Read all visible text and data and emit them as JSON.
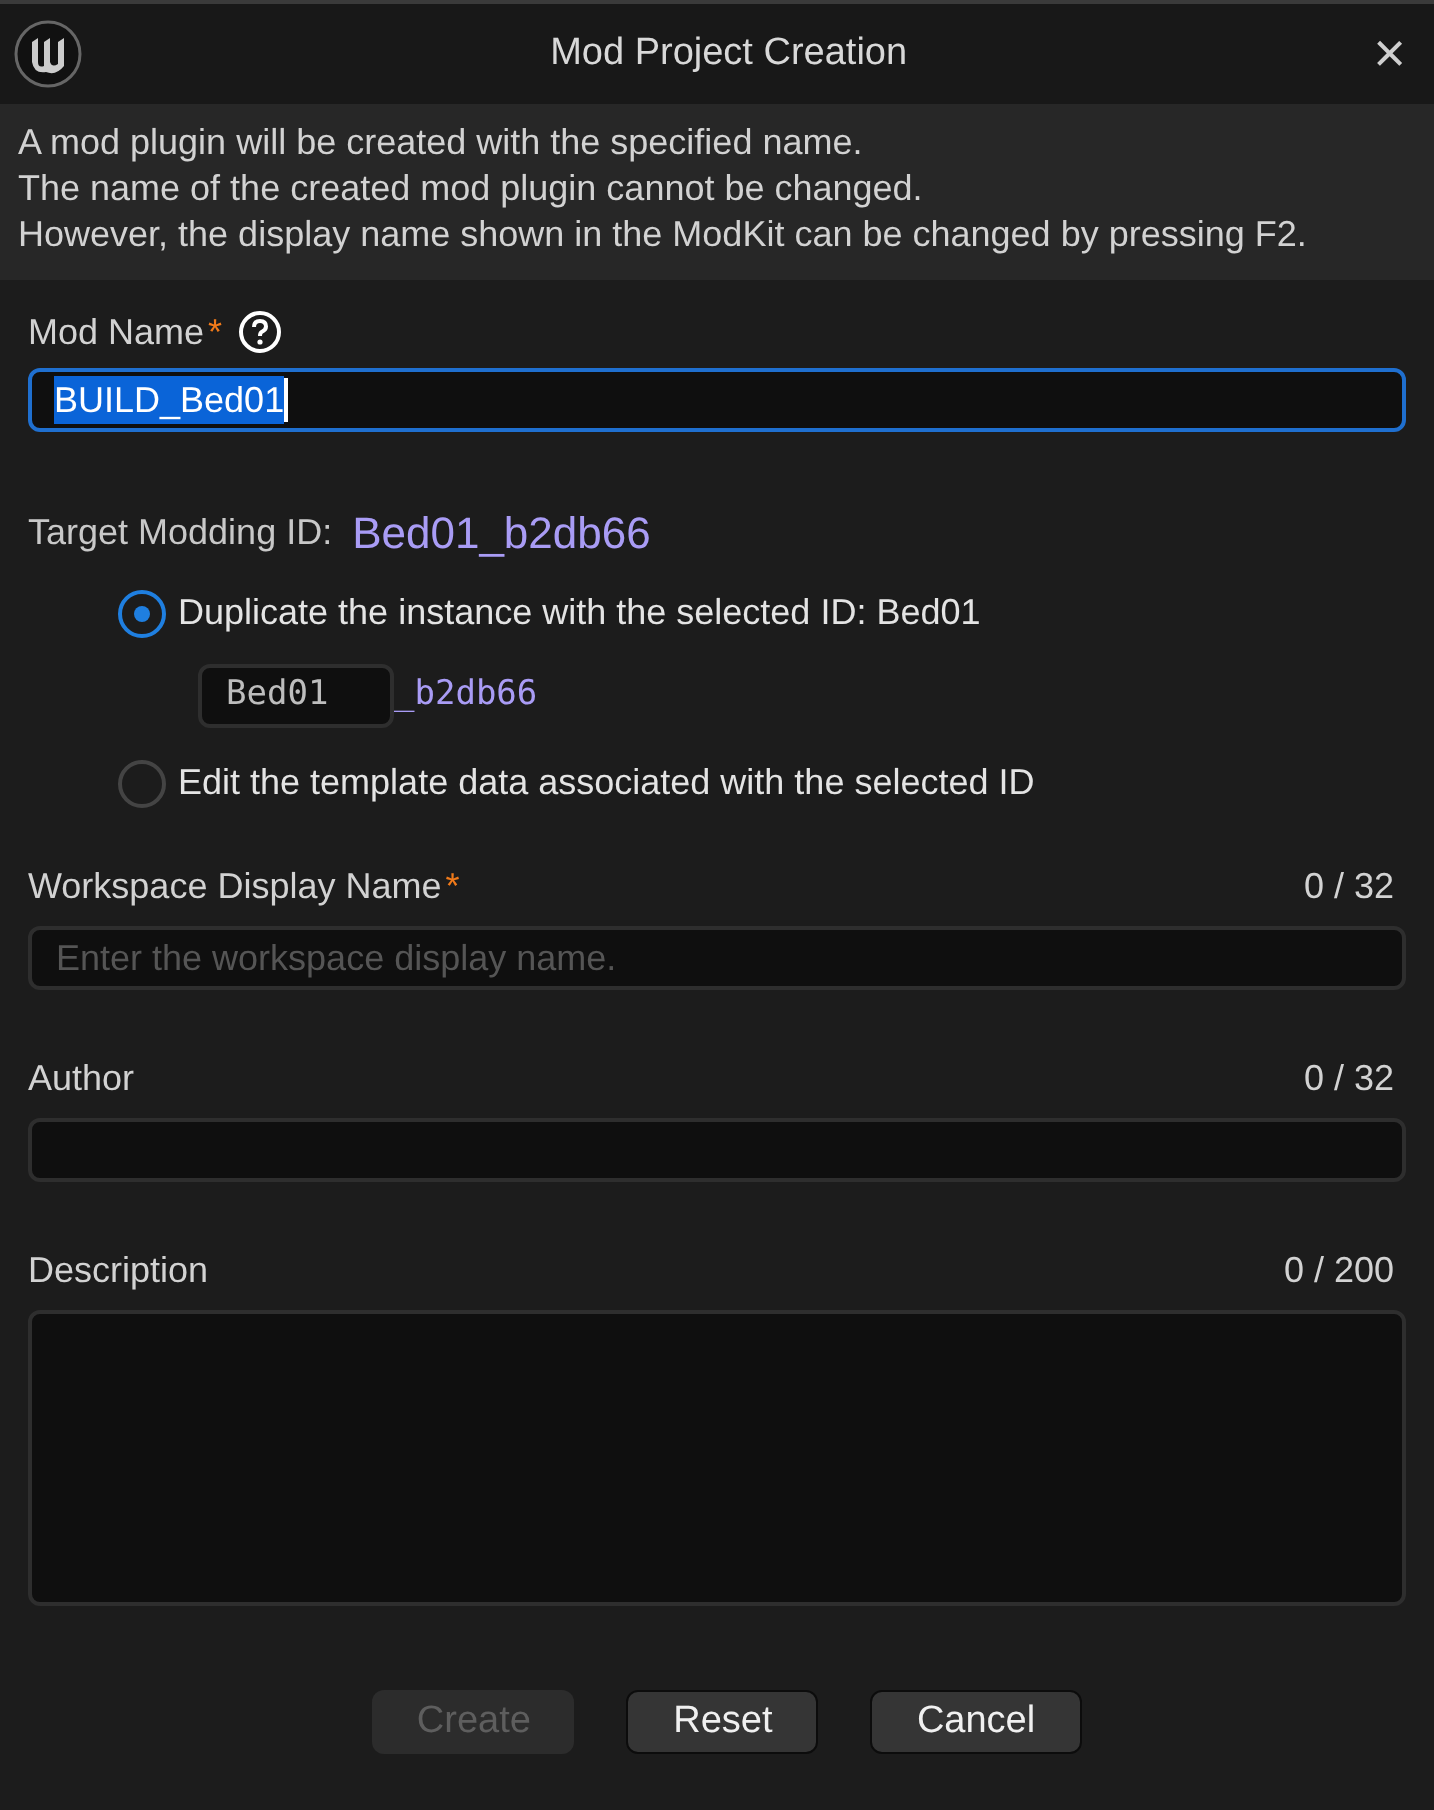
{
  "window": {
    "title": "Mod Project Creation",
    "close": "×"
  },
  "info": [
    "A mod plugin will be created with the specified name.",
    "The name of the created mod plugin cannot be changed.",
    "However, the display name shown in the ModKit can be changed by pressing F2."
  ],
  "mod_name": {
    "label": "Mod Name",
    "required": "*",
    "value": "BUILD_Bed01",
    "focused": true,
    "text_selected": true
  },
  "target": {
    "label": "Target Modding ID:",
    "value": "Bed01_b2db66"
  },
  "options": [
    {
      "label": "Duplicate the instance with the selected ID: Bed01",
      "selected": true,
      "id_field": {
        "value": "Bed01",
        "suffix": "_b2db66"
      }
    },
    {
      "label": "Edit the template data associated with the selected ID",
      "selected": false
    }
  ],
  "fields": [
    {
      "kind": "line",
      "label": "Workspace Display Name",
      "required": "*",
      "counter": "0 / 32",
      "placeholder": "Enter the workspace display name."
    },
    {
      "kind": "line",
      "label": "Author",
      "counter": "0 / 32"
    },
    {
      "kind": "area",
      "label": "Description",
      "counter": "0 / 200"
    }
  ],
  "buttons": [
    {
      "label": "Create",
      "disabled": true
    },
    {
      "label": "Reset",
      "disabled": false
    },
    {
      "label": "Cancel",
      "disabled": false
    }
  ]
}
